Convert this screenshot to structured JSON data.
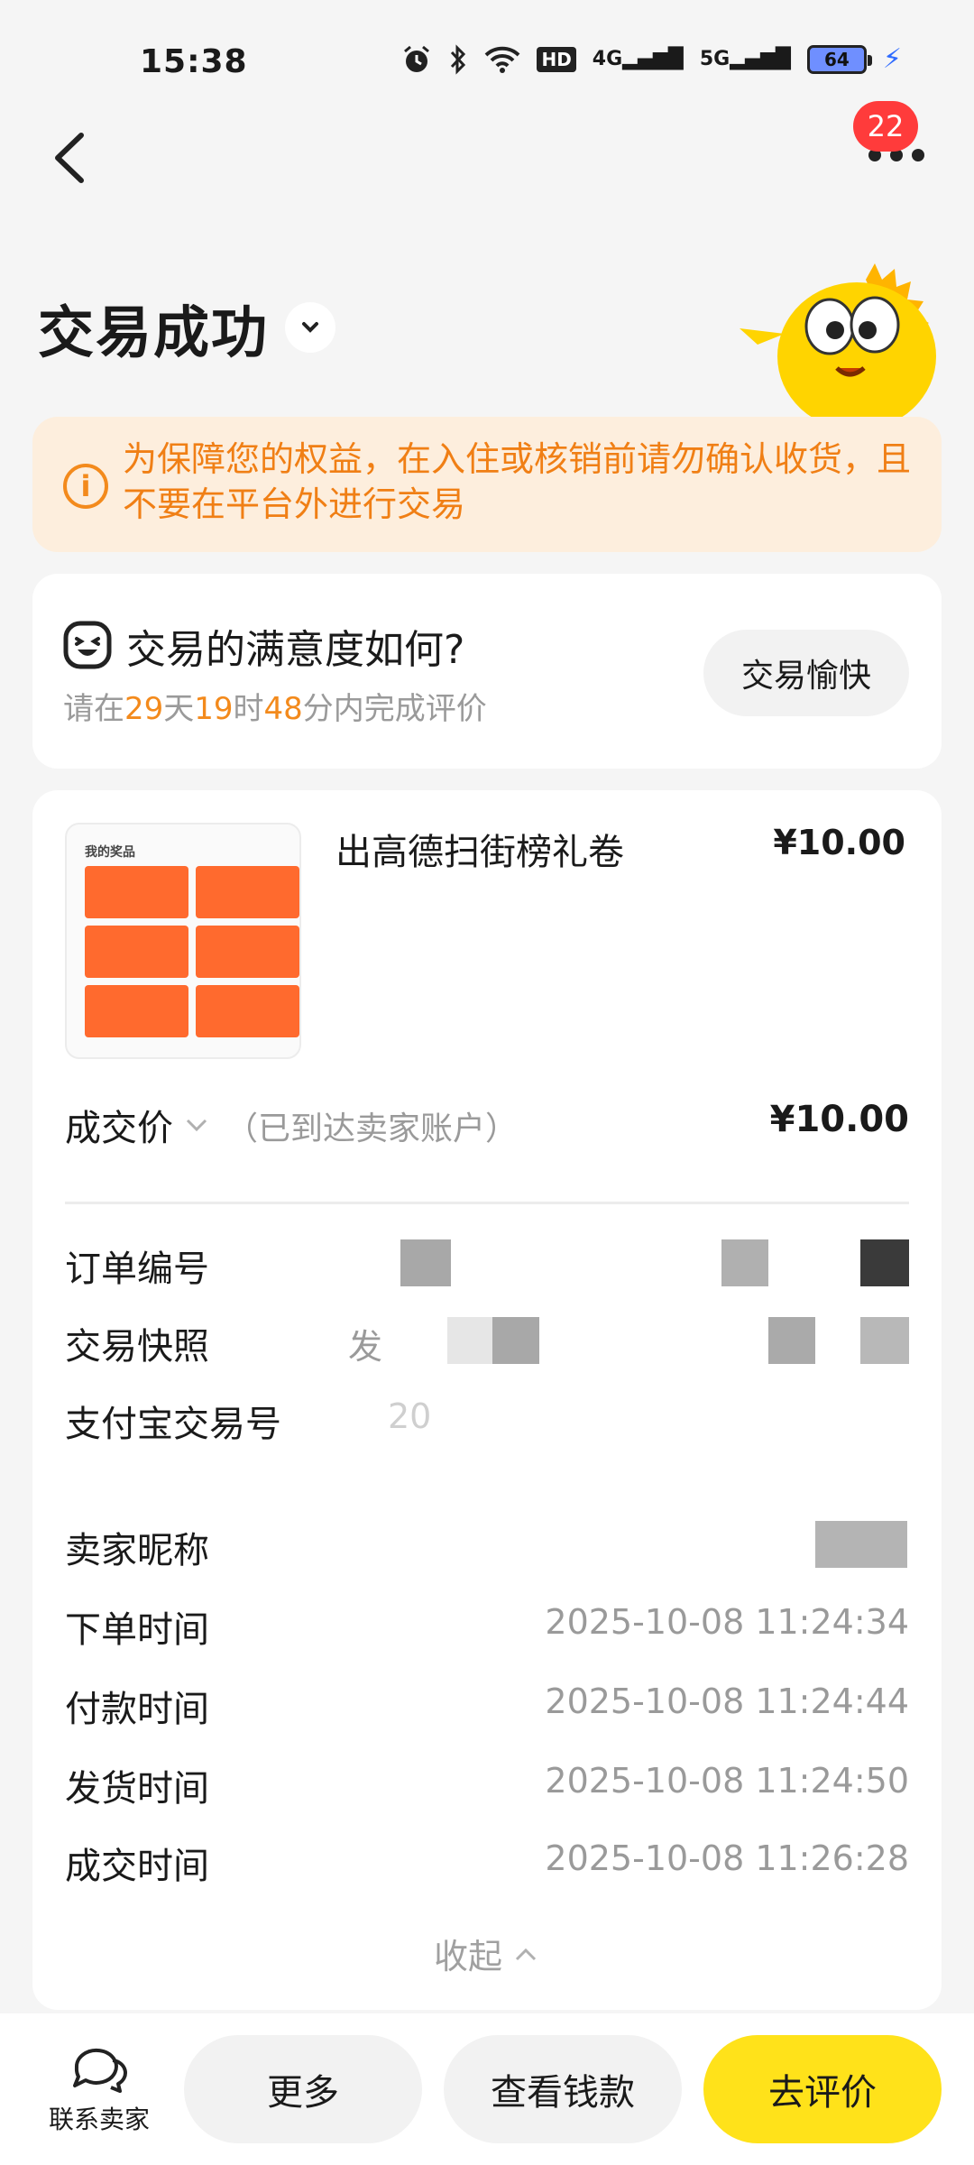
{
  "status_bar": {
    "time": "15:38",
    "icons": [
      "alarm-icon",
      "bluetooth-icon",
      "wifi-icon",
      "hd-icon",
      "signal-4g-icon",
      "signal-5g-icon"
    ],
    "network_labels": [
      "4G",
      "5G"
    ],
    "hd_label": "HD",
    "battery_level": "64"
  },
  "nav": {
    "notification_count": "22"
  },
  "header": {
    "title": "交易成功"
  },
  "notice": {
    "text": "为保障您的权益，在入住或核销前请勿确认收货，且不要在平台外进行交易"
  },
  "satisfaction": {
    "title": "交易的满意度如何?",
    "deadline_prefix": "请在",
    "days": "29",
    "days_unit": "天",
    "hours": "19",
    "hours_unit": "时",
    "minutes": "48",
    "minutes_suffix": "分内完成评价",
    "button_label": "交易愉快"
  },
  "product": {
    "name": "出高德扫街榜礼卷",
    "price": "¥10.00",
    "thumb_heading": "我的奖品"
  },
  "deal": {
    "label": "成交价",
    "note": "（已到达卖家账户）",
    "price": "¥10.00"
  },
  "details": {
    "order_number_label": "订单编号",
    "snapshot_label": "交易快照",
    "snapshot_value_start": "发",
    "alipay_label": "支付宝交易号",
    "alipay_value_start": "20",
    "seller_label": "卖家昵称",
    "times": [
      {
        "label": "下单时间",
        "value": "2025-10-08 11:24:34"
      },
      {
        "label": "付款时间",
        "value": "2025-10-08 11:24:44"
      },
      {
        "label": "发货时间",
        "value": "2025-10-08 11:24:50"
      },
      {
        "label": "成交时间",
        "value": "2025-10-08 11:26:28"
      }
    ],
    "collapse_label": "收起"
  },
  "bottom_bar": {
    "contact_label": "联系卖家",
    "more_label": "更多",
    "view_payment_label": "查看钱款",
    "review_label": "去评价"
  },
  "colors": {
    "accent_orange": "#f38a1c",
    "review_yellow": "#ffe21a",
    "badge_red": "#ff3b3b"
  }
}
